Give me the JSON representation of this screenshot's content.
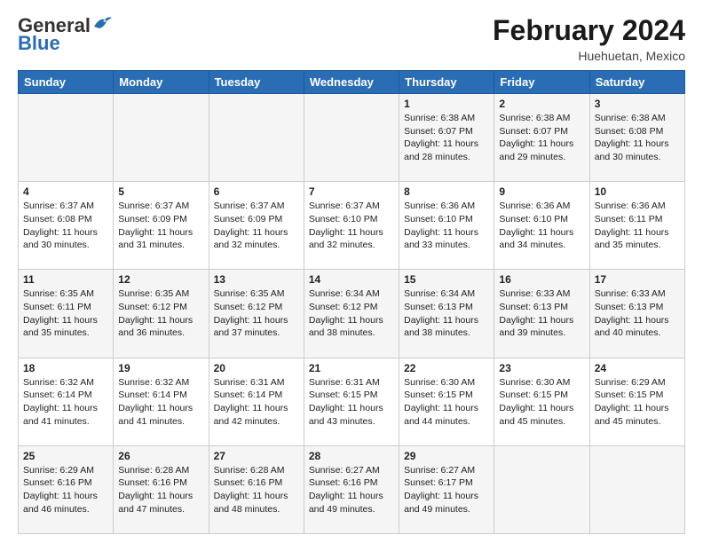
{
  "logo": {
    "general": "General",
    "blue": "Blue"
  },
  "title": {
    "month_year": "February 2024",
    "location": "Huehuetan, Mexico"
  },
  "weekdays": [
    "Sunday",
    "Monday",
    "Tuesday",
    "Wednesday",
    "Thursday",
    "Friday",
    "Saturday"
  ],
  "weeks": [
    [
      {
        "day": "",
        "info": ""
      },
      {
        "day": "",
        "info": ""
      },
      {
        "day": "",
        "info": ""
      },
      {
        "day": "",
        "info": ""
      },
      {
        "day": "1",
        "info": "Sunrise: 6:38 AM\nSunset: 6:07 PM\nDaylight: 11 hours and 28 minutes."
      },
      {
        "day": "2",
        "info": "Sunrise: 6:38 AM\nSunset: 6:07 PM\nDaylight: 11 hours and 29 minutes."
      },
      {
        "day": "3",
        "info": "Sunrise: 6:38 AM\nSunset: 6:08 PM\nDaylight: 11 hours and 30 minutes."
      }
    ],
    [
      {
        "day": "4",
        "info": "Sunrise: 6:37 AM\nSunset: 6:08 PM\nDaylight: 11 hours and 30 minutes."
      },
      {
        "day": "5",
        "info": "Sunrise: 6:37 AM\nSunset: 6:09 PM\nDaylight: 11 hours and 31 minutes."
      },
      {
        "day": "6",
        "info": "Sunrise: 6:37 AM\nSunset: 6:09 PM\nDaylight: 11 hours and 32 minutes."
      },
      {
        "day": "7",
        "info": "Sunrise: 6:37 AM\nSunset: 6:10 PM\nDaylight: 11 hours and 32 minutes."
      },
      {
        "day": "8",
        "info": "Sunrise: 6:36 AM\nSunset: 6:10 PM\nDaylight: 11 hours and 33 minutes."
      },
      {
        "day": "9",
        "info": "Sunrise: 6:36 AM\nSunset: 6:10 PM\nDaylight: 11 hours and 34 minutes."
      },
      {
        "day": "10",
        "info": "Sunrise: 6:36 AM\nSunset: 6:11 PM\nDaylight: 11 hours and 35 minutes."
      }
    ],
    [
      {
        "day": "11",
        "info": "Sunrise: 6:35 AM\nSunset: 6:11 PM\nDaylight: 11 hours and 35 minutes."
      },
      {
        "day": "12",
        "info": "Sunrise: 6:35 AM\nSunset: 6:12 PM\nDaylight: 11 hours and 36 minutes."
      },
      {
        "day": "13",
        "info": "Sunrise: 6:35 AM\nSunset: 6:12 PM\nDaylight: 11 hours and 37 minutes."
      },
      {
        "day": "14",
        "info": "Sunrise: 6:34 AM\nSunset: 6:12 PM\nDaylight: 11 hours and 38 minutes."
      },
      {
        "day": "15",
        "info": "Sunrise: 6:34 AM\nSunset: 6:13 PM\nDaylight: 11 hours and 38 minutes."
      },
      {
        "day": "16",
        "info": "Sunrise: 6:33 AM\nSunset: 6:13 PM\nDaylight: 11 hours and 39 minutes."
      },
      {
        "day": "17",
        "info": "Sunrise: 6:33 AM\nSunset: 6:13 PM\nDaylight: 11 hours and 40 minutes."
      }
    ],
    [
      {
        "day": "18",
        "info": "Sunrise: 6:32 AM\nSunset: 6:14 PM\nDaylight: 11 hours and 41 minutes."
      },
      {
        "day": "19",
        "info": "Sunrise: 6:32 AM\nSunset: 6:14 PM\nDaylight: 11 hours and 41 minutes."
      },
      {
        "day": "20",
        "info": "Sunrise: 6:31 AM\nSunset: 6:14 PM\nDaylight: 11 hours and 42 minutes."
      },
      {
        "day": "21",
        "info": "Sunrise: 6:31 AM\nSunset: 6:15 PM\nDaylight: 11 hours and 43 minutes."
      },
      {
        "day": "22",
        "info": "Sunrise: 6:30 AM\nSunset: 6:15 PM\nDaylight: 11 hours and 44 minutes."
      },
      {
        "day": "23",
        "info": "Sunrise: 6:30 AM\nSunset: 6:15 PM\nDaylight: 11 hours and 45 minutes."
      },
      {
        "day": "24",
        "info": "Sunrise: 6:29 AM\nSunset: 6:15 PM\nDaylight: 11 hours and 45 minutes."
      }
    ],
    [
      {
        "day": "25",
        "info": "Sunrise: 6:29 AM\nSunset: 6:16 PM\nDaylight: 11 hours and 46 minutes."
      },
      {
        "day": "26",
        "info": "Sunrise: 6:28 AM\nSunset: 6:16 PM\nDaylight: 11 hours and 47 minutes."
      },
      {
        "day": "27",
        "info": "Sunrise: 6:28 AM\nSunset: 6:16 PM\nDaylight: 11 hours and 48 minutes."
      },
      {
        "day": "28",
        "info": "Sunrise: 6:27 AM\nSunset: 6:16 PM\nDaylight: 11 hours and 49 minutes."
      },
      {
        "day": "29",
        "info": "Sunrise: 6:27 AM\nSunset: 6:17 PM\nDaylight: 11 hours and 49 minutes."
      },
      {
        "day": "",
        "info": ""
      },
      {
        "day": "",
        "info": ""
      }
    ]
  ]
}
